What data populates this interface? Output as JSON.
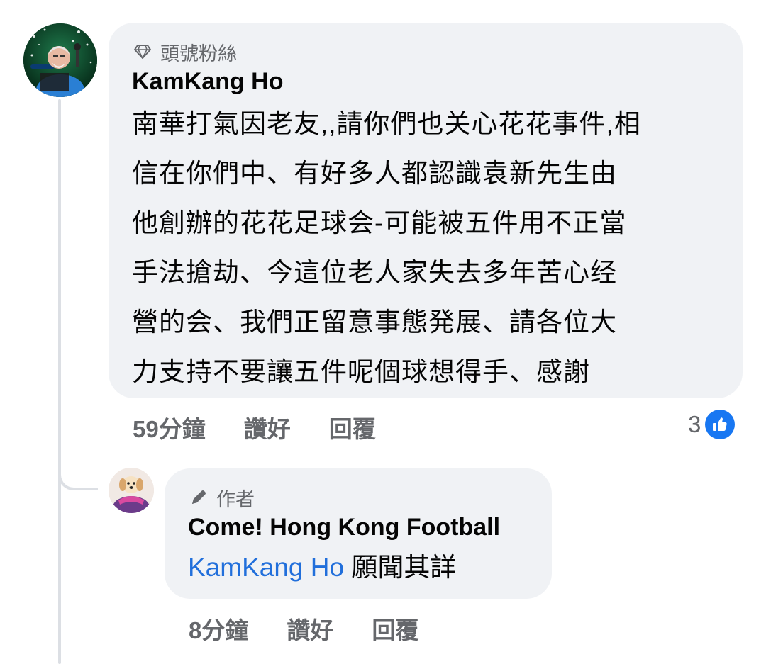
{
  "comment": {
    "badge": "頭號粉絲",
    "badge_icon": "diamond-icon",
    "author": "KamKang Ho",
    "lines": [
      "南華打氣因老友,,請你們也关心花花事件,相",
      "信在你們中、有好多人都認識袁新先生由",
      "他創辦的花花足球会-可能被五件用不正當",
      "手法搶劫、今這位老人家失去多年苦心经",
      "營的会、我們正留意事態発展、請各位大",
      "力支持不要讓五件呢個球想得手、感謝"
    ],
    "time": "59分鐘",
    "like_label": "讚好",
    "reply_label": "回覆",
    "reaction_count": "3",
    "reaction_icon": "like-thumb-icon",
    "reaction_color": "#1877f2"
  },
  "reply": {
    "badge": "作者",
    "badge_icon": "pencil-icon",
    "author": "Come! Hong Kong Football",
    "mention": "KamKang Ho",
    "text": " 願聞其詳",
    "time": "8分鐘",
    "like_label": "讚好",
    "reply_label": "回覆"
  },
  "colors": {
    "bubble_bg": "#f0f2f5",
    "secondary_text": "#65676b",
    "mention_link": "#216fdb",
    "thread_line": "#dcdfe4"
  }
}
